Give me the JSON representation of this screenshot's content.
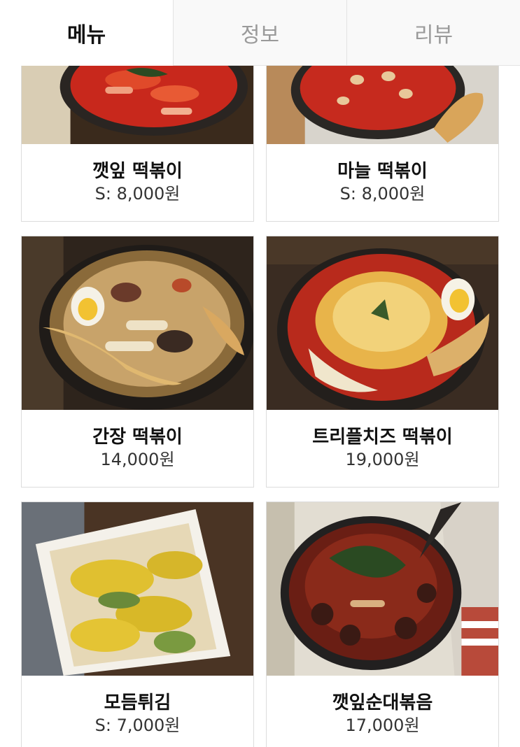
{
  "tabs": [
    {
      "label": "메뉴",
      "active": true
    },
    {
      "label": "정보",
      "active": false
    },
    {
      "label": "리뷰",
      "active": false
    }
  ],
  "menu": {
    "items": [
      {
        "name": "깻잎 떡볶이",
        "price": "S: 8,000원"
      },
      {
        "name": "마늘 떡볶이",
        "price": "S: 8,000원"
      },
      {
        "name": "간장 떡볶이",
        "price": "14,000원"
      },
      {
        "name": "트리플치즈 떡볶이",
        "price": "19,000원"
      },
      {
        "name": "모듬튀김",
        "price": "S: 7,000원"
      },
      {
        "name": "깻잎순대볶음",
        "price": "17,000원"
      }
    ]
  },
  "colors": {
    "active_tab": "#111111",
    "inactive_tab": "#9a9a9a",
    "card_border": "#dcdcdc"
  }
}
